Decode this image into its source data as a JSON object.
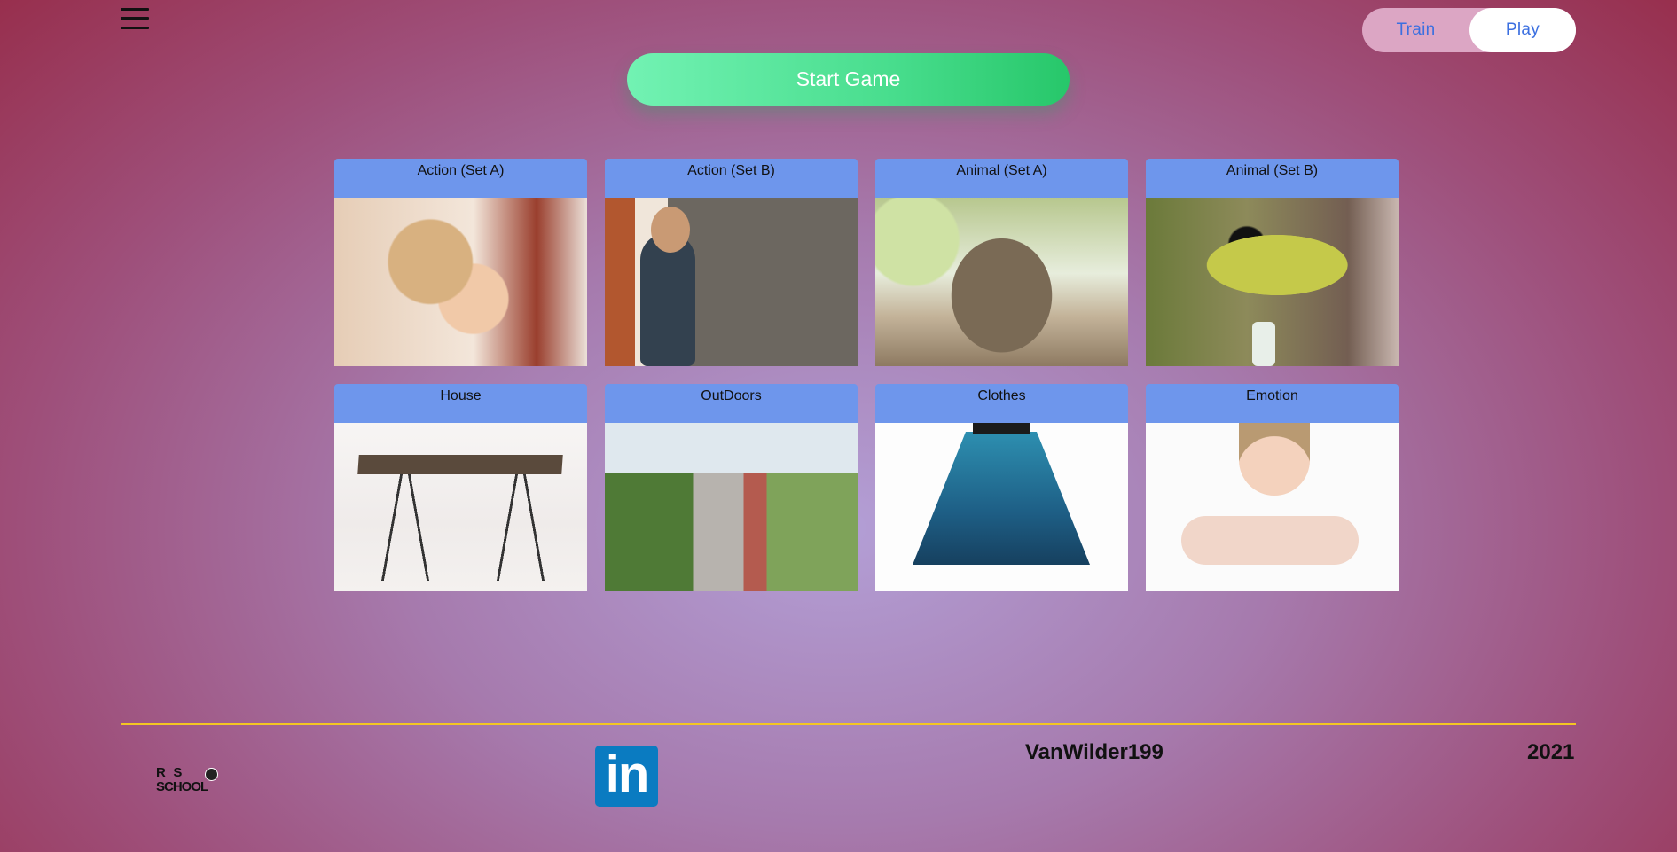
{
  "header": {
    "menu_icon": "hamburger-menu-icon",
    "mode_toggle": {
      "train_label": "Train",
      "play_label": "Play",
      "active": "Play"
    },
    "start_button_label": "Start Game"
  },
  "categories": [
    {
      "label": "Action (Set A)",
      "image": "child-covering-face"
    },
    {
      "label": "Action (Set B)",
      "image": "boy-opening-door"
    },
    {
      "label": "Animal (Set A)",
      "image": "cat-sitting"
    },
    {
      "label": "Animal (Set B)",
      "image": "bird-on-branch"
    },
    {
      "label": "House",
      "image": "table"
    },
    {
      "label": "OutDoors",
      "image": "street-sidewalk"
    },
    {
      "label": "Clothes",
      "image": "blue-skirt"
    },
    {
      "label": "Emotion",
      "image": "sad-boy"
    }
  ],
  "footer": {
    "logo_line1": "R   S",
    "logo_line2": "SCHOOL",
    "linkedin_label": "in",
    "author": "VanWilder199",
    "year": "2021"
  },
  "colors": {
    "card_header": "#6e96ec",
    "start_button": "#48dd8d",
    "footer_line": "#f3c623",
    "toggle_text": "#3b6fe0"
  }
}
